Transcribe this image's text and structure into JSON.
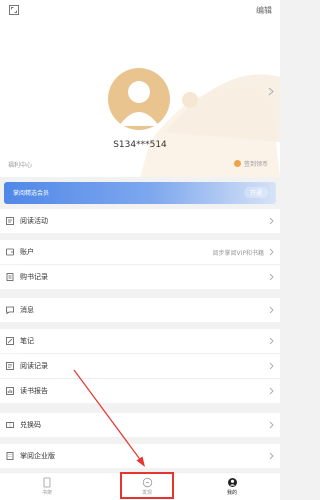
{
  "header": {
    "edit_label": "编辑"
  },
  "profile": {
    "username": "S134***514",
    "welfare_label": "福利中心",
    "sign_label": "签到领币"
  },
  "vip": {
    "text": "掌阅精选会员",
    "button": "开通"
  },
  "menu": [
    {
      "label": "阅读活动",
      "extra": ""
    },
    {
      "label": "账户",
      "extra": "阅步掌阅VIP和书籍"
    },
    {
      "label": "购书记录",
      "extra": ""
    },
    {
      "label": "消息",
      "extra": ""
    },
    {
      "label": "笔记",
      "extra": ""
    },
    {
      "label": "阅读记录",
      "extra": ""
    },
    {
      "label": "读书报告",
      "extra": ""
    },
    {
      "label": "兑换码",
      "extra": ""
    },
    {
      "label": "掌阅企业版",
      "extra": ""
    }
  ],
  "tabs": [
    {
      "label": "书架"
    },
    {
      "label": "发现"
    },
    {
      "label": "我的"
    }
  ],
  "colors": {
    "accent": "#4f88e8",
    "avatar": "#e9c48e",
    "highlight": "#e8342f"
  }
}
